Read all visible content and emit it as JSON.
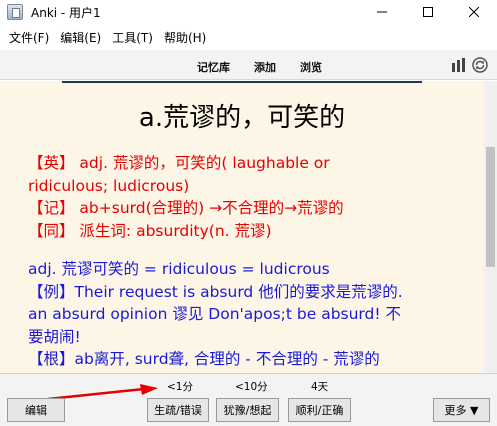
{
  "window": {
    "title": "Anki - 用户1"
  },
  "menu": {
    "items": [
      "文件(F)",
      "编辑(E)",
      "工具(T)",
      "帮助(H)"
    ]
  },
  "toolbar": {
    "links": [
      "记忆库",
      "添加",
      "浏览"
    ]
  },
  "card": {
    "question": "a.荒谬的，可笑的",
    "lines": [
      "【英】 adj. 荒谬的，可笑的( laughable or",
      "ridiculous; ludicrous)",
      "【记】 ab+surd(合理的) →不合理的→荒谬的",
      "【同】 派生词: absurdity(n. 荒谬)",
      "adj. 荒谬可笑的 = ridiculous = ludicrous",
      "【例】Their request is absurd 他们的要求是荒谬的.",
      "an absurd opinion 谬见 Don'apos;t be absurd! 不",
      "要胡闹!",
      "【根】ab离开, surd聋, 合理的 - 不合理的 - 荒谬的"
    ],
    "colors": {
      "english_note": "#e60000",
      "usage_note": "#1a1ad6",
      "background": "#fdf5e6"
    }
  },
  "answer": {
    "edit_label": "编辑",
    "intervals": [
      "<1分",
      "<10分",
      "4天"
    ],
    "buttons": [
      "生疏/错误",
      "犹豫/想起",
      "顺利/正确"
    ],
    "more_label": "更多 ▼"
  }
}
